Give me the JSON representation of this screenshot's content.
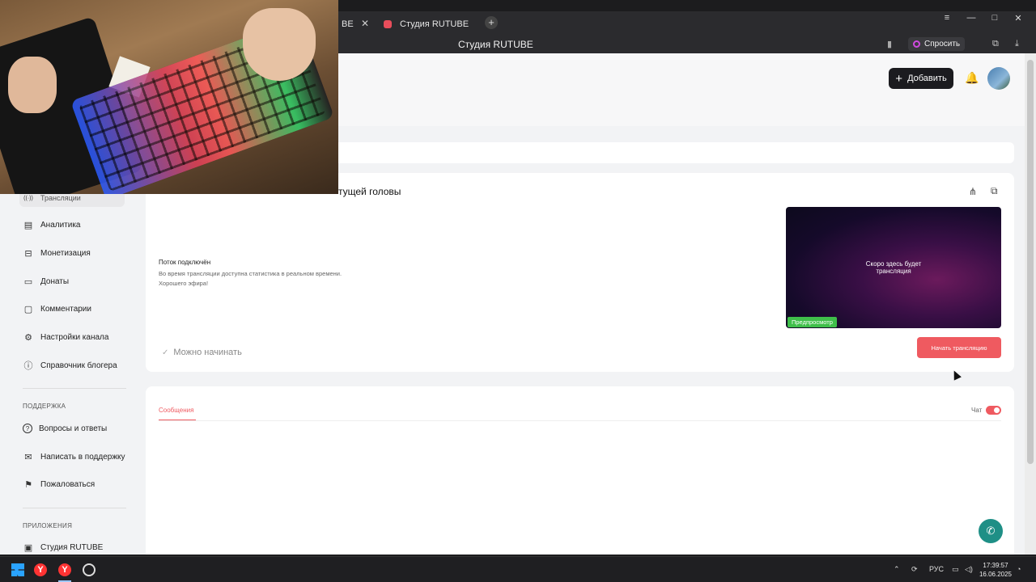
{
  "browser": {
    "tabs": [
      {
        "label": "BE"
      },
      {
        "label": "Студия RUTUBE"
      }
    ],
    "page_title": "Студия RUTUBE",
    "ask_label": "Спросить",
    "new_tab_glyph": "+",
    "close_glyph": "✕",
    "menu_glyph": "≡",
    "minimize_glyph": "—",
    "maximize_glyph": "□",
    "win_close_glyph": "✕"
  },
  "header": {
    "add_label": "Добавить",
    "add_glyph": "+",
    "bell_glyph": "🔔"
  },
  "sidebar": {
    "items": [
      {
        "label": "Трансляции",
        "icon": "broadcast-icon",
        "glyph": "((·))"
      },
      {
        "label": "Аналитика",
        "icon": "analytics-icon",
        "glyph": "▤"
      },
      {
        "label": "Монетизация",
        "icon": "monetization-icon",
        "glyph": "⊟"
      },
      {
        "label": "Донаты",
        "icon": "donations-icon",
        "glyph": "▭"
      },
      {
        "label": "Комментарии",
        "icon": "comments-icon",
        "glyph": "▢"
      },
      {
        "label": "Настройки канала",
        "icon": "gear-icon",
        "glyph": "⚙"
      },
      {
        "label": "Справочник блогера",
        "icon": "info-icon",
        "glyph": "ⓘ"
      }
    ],
    "support_heading": "ПОДДЕРЖКА",
    "support_items": [
      {
        "label": "Вопросы и ответы",
        "icon": "help-icon",
        "glyph": "?"
      },
      {
        "label": "Написать в поддержку",
        "icon": "mail-icon",
        "glyph": "✉"
      },
      {
        "label": "Пожаловаться",
        "icon": "flag-icon",
        "glyph": "⚑"
      }
    ],
    "apps_heading": "ПРИЛОЖЕНИЯ",
    "apps_items": [
      {
        "label": "Студия RUTUBE",
        "icon": "studio-icon",
        "glyph": "▣"
      }
    ]
  },
  "stream": {
    "title": "тущей головы",
    "connected_title": "Поток подключён",
    "connected_desc": "Во время трансляции доступна статистика в реальном времени.",
    "connected_wish": "Хорошего эфира!",
    "ready_label": "Можно начинать",
    "ready_glyph": "✓",
    "preview_text_1": "Скоро здесь будет",
    "preview_text_2": "трансляция",
    "preview_badge": "Предпросмотр",
    "start_label": "Начать трансляцию",
    "share_glyph": "⋔",
    "open_glyph": "⧉"
  },
  "chat": {
    "tab_label": "Сообщения",
    "toggle_label": "Чат",
    "toggle_on": true
  },
  "support_fab_glyph": "✆",
  "taskbar": {
    "lang": "РУС",
    "time": "17:39:57",
    "date": "16.06.2025",
    "yandex_glyph": "Y"
  },
  "colors": {
    "accent": "#ef5a60",
    "preview_badge": "#3fbf4a",
    "fab": "#1e8f86"
  }
}
